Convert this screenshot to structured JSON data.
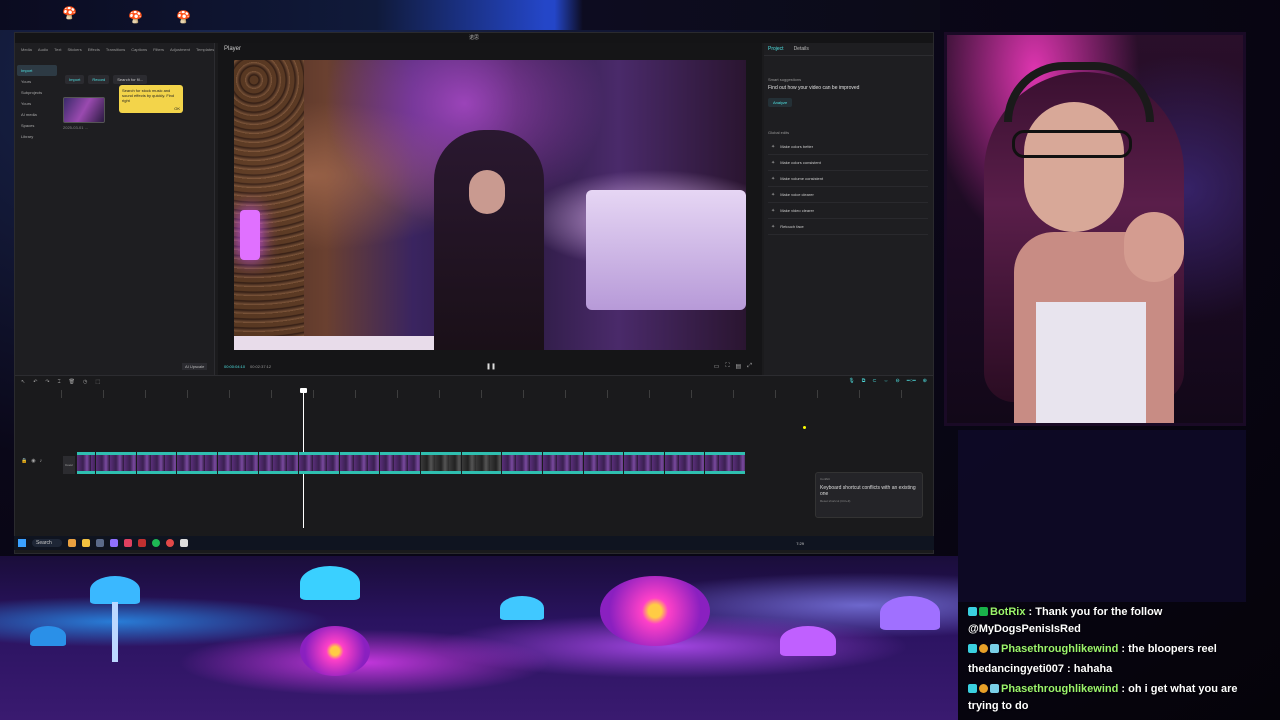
{
  "editor": {
    "window_title": "诺思",
    "media_panel": {
      "toolbar": [
        "Media",
        "Audio",
        "Text",
        "Stickers",
        "Effects",
        "Transitions",
        "Captions",
        "Filters",
        "Adjustment",
        "Templates"
      ],
      "nav": [
        "Import",
        "Yours",
        "Subprojects",
        "Yours",
        "AI media",
        "Spaces",
        "Library"
      ],
      "tabs": [
        "Import",
        "Record",
        "Search for fil..."
      ],
      "clip_name": "2025-03-01 ...",
      "tooltip_text": "Search for stock music and sound effects by quickly. Find right",
      "tooltip_ok": "OK"
    },
    "player": {
      "label": "Player",
      "ai_tag": "AI Upscale",
      "timecode_current": "00:00:04:10",
      "timecode_total": "00:02:37:12"
    },
    "right_panel": {
      "tabs": [
        "Project",
        "Details"
      ],
      "smart_label": "Smart suggestions",
      "headline": "Find out how your video can be improved",
      "analyze": "Analyze",
      "global_label": "Global edits",
      "items": [
        "Make colors better",
        "Make colors consistent",
        "Make volume consistent",
        "Make voice clearer",
        "Make video clearer",
        "Retouch face"
      ]
    },
    "timeline": {
      "cover_label": "Cover",
      "clip_dark_index": [
        8,
        9
      ],
      "clip_count": 16
    },
    "toast": {
      "title": "Conflict",
      "message": "Keyboard shortcut conflicts with an existing one",
      "detail": "Reset shortcut (Ctrl+Z)"
    },
    "taskbar": {
      "search": "Search",
      "time": "7:29"
    }
  },
  "chat": {
    "messages": [
      {
        "user": "BotRix",
        "user_class": "user-green",
        "badges": [
          "b-cyan",
          "b-mod"
        ],
        "text": "Thank you for the follow @MyDogsPenisIsRed"
      },
      {
        "user": "Phasethroughlikewind",
        "user_class": "user-green",
        "badges": [
          "b-cyan",
          "b-sub",
          "b-gift"
        ],
        "text": "the bloopers reel"
      },
      {
        "user": "thedancingyeti007",
        "user_class": "user-white",
        "badges": [],
        "text": "hahaha"
      },
      {
        "user": "Phasethroughlikewind",
        "user_class": "user-green",
        "badges": [
          "b-cyan",
          "b-sub",
          "b-gift"
        ],
        "text": "oh i get what you are trying to do"
      }
    ]
  },
  "colors": {
    "accent": "#4ee0e0",
    "tooltip": "#f3d44a",
    "chat_user": "#9cf56c"
  }
}
